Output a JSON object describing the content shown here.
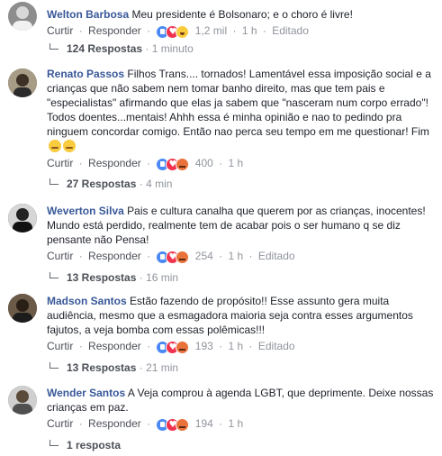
{
  "action_labels": {
    "like": "Curtir",
    "reply": "Responder",
    "edited": "Editado",
    "dot": "·"
  },
  "comments": [
    {
      "author": "Welton Barbosa",
      "text": "Meu presidente é Bolsonaro; e o choro é livre!",
      "reactions": [
        "like-icon",
        "love-icon",
        "haha-icon"
      ],
      "reaction_count": "1,2 mil",
      "time": "1 h",
      "edited": true,
      "replies_label": "124 Respostas",
      "replies_time": "1 minuto"
    },
    {
      "author": "Renato Passos",
      "text": "Filhos Trans.... tornados! Lamentável essa imposição social e a crianças que não sabem nem tomar banho direito, mas que tem pais e \"especialistas\" afirmando que elas ja sabem que \"nasceram num corpo errado\"! Todos doentes...mentais! Ahhh essa é minha opinião e nao to pedindo pra ninguem concordar comigo. Então nao perca seu tempo em me questionar! Fim",
      "reactions": [
        "like-icon",
        "love-icon",
        "angry-icon"
      ],
      "reaction_count": "400",
      "time": "1 h",
      "edited": false,
      "replies_label": "27 Respostas",
      "replies_time": "4 min"
    },
    {
      "author": "Weverton Silva",
      "text": "Pais e cultura canalha que querem por as crianças, inocentes! Mundo está perdido, realmente tem de acabar pois o ser humano q se diz pensante não Pensa!",
      "reactions": [
        "like-icon",
        "love-icon",
        "angry-icon"
      ],
      "reaction_count": "254",
      "time": "1 h",
      "edited": true,
      "replies_label": "13 Respostas",
      "replies_time": "16 min"
    },
    {
      "author": "Madson Santos",
      "text": "Estão fazendo de propósito!! Esse assunto gera muita audiência, mesmo que a esmagadora maioria seja contra esses argumentos fajutos, a veja bomba com essas polêmicas!!!",
      "reactions": [
        "like-icon",
        "love-icon",
        "angry-icon"
      ],
      "reaction_count": "193",
      "time": "1 h",
      "edited": true,
      "replies_label": "13 Respostas",
      "replies_time": "21 min"
    },
    {
      "author": "Wender Santos",
      "text": "A Veja comprou à agenda LGBT, que deprimente. Deixe nossas crianças em paz.",
      "reactions": [
        "like-icon",
        "love-icon",
        "angry-icon"
      ],
      "reaction_count": "194",
      "time": "1 h",
      "edited": false,
      "replies_label": "1 resposta",
      "replies_time": ""
    }
  ]
}
